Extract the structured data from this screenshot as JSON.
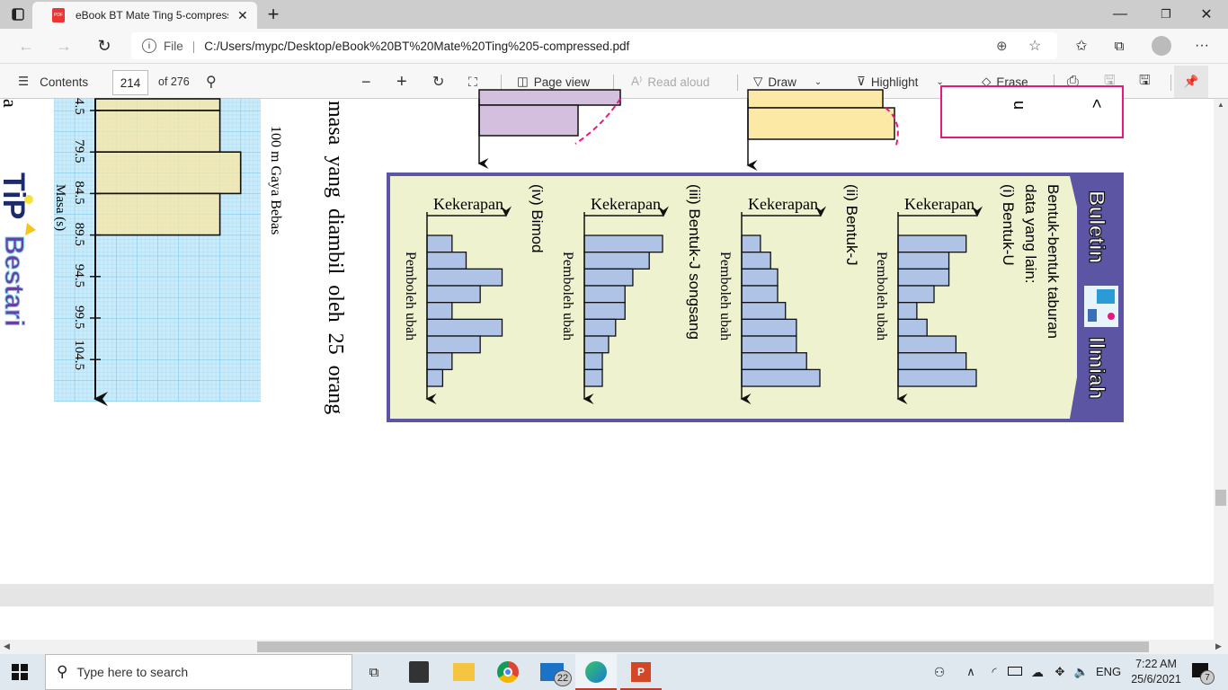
{
  "browser": {
    "tab_title": "eBook BT Mate Ting 5-compressed.pdf",
    "url_scheme_label": "File",
    "url": "C:/Users/mypc/Desktop/eBook%20BT%20Mate%20Ting%205-compressed.pdf",
    "icons": [
      "tab-actions-icon",
      "pdf-icon",
      "close-icon",
      "new-tab-icon",
      "back-icon",
      "forward-icon",
      "refresh-icon",
      "info-icon",
      "zoom-icon",
      "add-favorite-icon",
      "favorites-icon",
      "collections-icon",
      "profile-icon",
      "more-icon"
    ]
  },
  "pdf_toolbar": {
    "contents": "Contents",
    "page": "214",
    "of_pages": "of 276",
    "page_view": "Page view",
    "read_aloud": "Read aloud",
    "draw": "Draw",
    "highlight": "Highlight",
    "erase": "Erase"
  },
  "page": {
    "left_fragment": "a",
    "logo_text": "TiP Bestari",
    "body_text": "masa yang diambil oleh 25 orang",
    "histogram": {
      "title": "100 m Gaya Bebas",
      "xlabel": "Masa (s)",
      "tick_labels": [
        "4.5",
        "79.5",
        "84.5",
        "89.5",
        "94.5",
        "99.5",
        "104.5"
      ],
      "frequencies": [
        6,
        6,
        7,
        6
      ],
      "fill": "#fbe7a3",
      "grid_color": "#9fd6f0"
    },
    "pink_box_fragments": [
      "u",
      "<"
    ],
    "bulletin": {
      "header_left": "Buletin",
      "header_right": "Ilmiah",
      "intro_line1": "Bentuk-bentuk taburan",
      "intro_line2": "data yang lain:",
      "frame_color": "#5b55a3",
      "bg_color": "#eef2cf",
      "bar_color": "#aec3e6",
      "charts": [
        {
          "num": "(i)",
          "name": "Bentuk-U",
          "ylabel": "Kekerapan",
          "xlabel": "Pemboleh ubah",
          "values": [
            8.7,
            6.5,
            6.5,
            4.6,
            2.4,
            3.7,
            7.4,
            8.7,
            10
          ]
        },
        {
          "num": "(ii)",
          "name": "Bentuk-J",
          "ylabel": "Kekerapan",
          "xlabel": "Pemboleh ubah",
          "values": [
            2.4,
            3.7,
            4.6,
            4.6,
            5.6,
            7,
            7,
            8.3,
            10
          ]
        },
        {
          "num": "(iii)",
          "name": "Bentuk-J songsang",
          "ylabel": "Kekerapan",
          "xlabel": "Pemboleh ubah",
          "values": [
            10,
            8.3,
            6.2,
            5.2,
            5.2,
            4,
            3.1,
            2.3,
            2.3
          ]
        },
        {
          "num": "(iv)",
          "name": "Bimod",
          "ylabel": "Kekerapan",
          "xlabel": "Pemboleh ubah",
          "values": [
            3.2,
            5,
            9.6,
            6.8,
            3.2,
            9.6,
            6.8,
            3.2,
            2
          ]
        }
      ]
    }
  },
  "taskbar": {
    "search_placeholder": "Type here to search",
    "mail_badge": "22",
    "language": "ENG",
    "time": "7:22 AM",
    "date": "25/6/2021",
    "notification_count": "7"
  }
}
